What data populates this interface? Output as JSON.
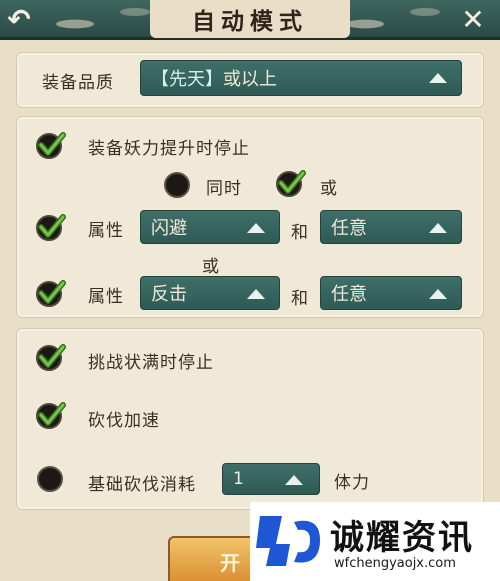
{
  "header": {
    "title": "自动模式",
    "back_glyph": "↶",
    "close_glyph": "✕"
  },
  "quality": {
    "label": "装备品质",
    "value_prefix": "【先天】",
    "value_suffix": "或以上"
  },
  "attribute_section": {
    "stop_on_power": {
      "label": "装备妖力提升时停止",
      "checked": true
    },
    "mode": {
      "both_label": "同时",
      "either_label": "或",
      "selected": "either"
    },
    "row1": {
      "label": "属性",
      "checked": true,
      "value1": "闪避",
      "conj": "和",
      "value2": "任意"
    },
    "or_label": "或",
    "row2": {
      "label": "属性",
      "checked": true,
      "value1": "反击",
      "conj": "和",
      "value2": "任意"
    }
  },
  "other_section": {
    "stop_on_challenge": {
      "label": "挑战状满时停止",
      "checked": true
    },
    "speed_up": {
      "label": "砍伐加速",
      "checked": true
    },
    "base_cost": {
      "label": "基础砍伐消耗",
      "checked": false,
      "value": "1",
      "unit": "体力"
    }
  },
  "start_button": {
    "label": "开"
  },
  "watermark": {
    "title": "诚耀资讯",
    "url": "wfchengyaojx.com"
  },
  "colors": {
    "accent_teal": "#2f5a55",
    "check_green": "#4c9a2f",
    "background": "#e9dfc9"
  }
}
